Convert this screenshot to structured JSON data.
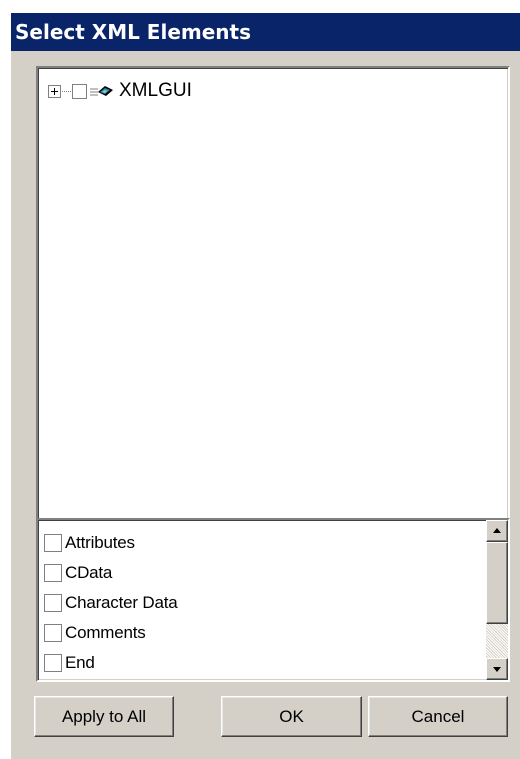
{
  "window": {
    "title": "Select XML Elements"
  },
  "tree": {
    "root": {
      "label": "XMLGUI",
      "expander": "plus",
      "checked": false,
      "icon": "xml-element-icon"
    }
  },
  "filter_list": {
    "items": [
      {
        "label": "Attributes",
        "checked": false
      },
      {
        "label": "CData",
        "checked": false
      },
      {
        "label": "Character Data",
        "checked": false
      },
      {
        "label": "Comments",
        "checked": false
      },
      {
        "label": "End",
        "checked": false
      }
    ]
  },
  "buttons": {
    "apply_all": "Apply to All",
    "ok": "OK",
    "cancel": "Cancel"
  },
  "colors": {
    "title_bar": "#0a246a",
    "face": "#d4d0c8",
    "window": "#ffffff"
  }
}
